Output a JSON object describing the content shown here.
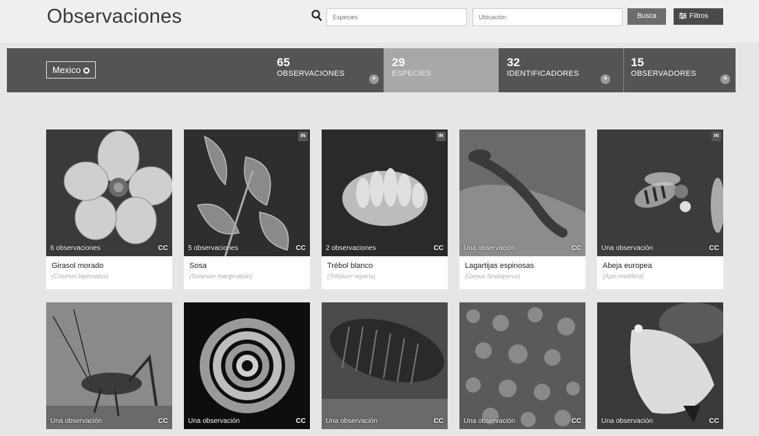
{
  "header": {
    "title": "Observaciones",
    "search_placeholder": "Especies",
    "location_placeholder": "Ubicación",
    "search_button": "Busca",
    "filters_button": "Filtros"
  },
  "stats": {
    "place": "Mexico",
    "observations": {
      "count": "65",
      "label": "OBSERVACIONES"
    },
    "species": {
      "count": "29",
      "label": "ESPECIES"
    },
    "identifiers": {
      "count": "32",
      "label": "IDENTIFICADORES"
    },
    "observers": {
      "count": "15",
      "label": "OBSERVADORES"
    }
  },
  "cards": [
    {
      "count": "6 observaciones",
      "cc": "CC",
      "badge": "",
      "common": "Girasol morado",
      "sci": "(Cosmos bipinnatus)"
    },
    {
      "count": "5 observaciones",
      "cc": "CC",
      "badge": "IN",
      "common": "Sosa",
      "sci": "(Solanum marginatum)"
    },
    {
      "count": "2 observaciones",
      "cc": "CC",
      "badge": "IN",
      "common": "Trébol blanco",
      "sci": "(Trifolium repens)"
    },
    {
      "count": "Una observación",
      "cc": "CC",
      "badge": "",
      "common": "Lagartijas espinosas",
      "sci": "(Genus Sceloporus)"
    },
    {
      "count": "Una observación",
      "cc": "CC",
      "badge": "IN",
      "common": "Abeja europea",
      "sci": "(Apis mellifera)"
    },
    {
      "count": "Una observación",
      "cc": "CC",
      "badge": ""
    },
    {
      "count": "Una observación",
      "cc": "CC",
      "badge": ""
    },
    {
      "count": "Una observación",
      "cc": "CC",
      "badge": ""
    },
    {
      "count": "Una observación",
      "cc": "CC",
      "badge": ""
    },
    {
      "count": "Una observación",
      "cc": "CC",
      "badge": ""
    }
  ]
}
